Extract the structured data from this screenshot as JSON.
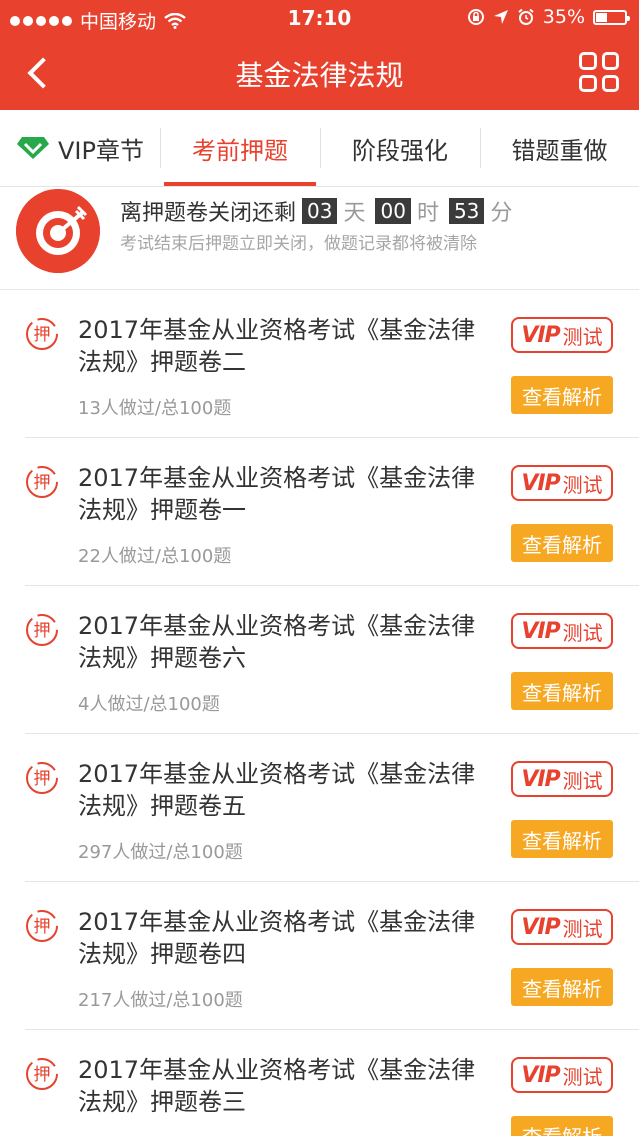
{
  "status_bar": {
    "carrier": "中国移动",
    "time": "17:10",
    "battery": "35%",
    "battery_level": 0.35
  },
  "nav": {
    "title": "基金法律法规"
  },
  "tabs": [
    {
      "label": "VIP章节",
      "active": false
    },
    {
      "label": "考前押题",
      "active": true
    },
    {
      "label": "阶段强化",
      "active": false
    },
    {
      "label": "错题重做",
      "active": false
    }
  ],
  "countdown": {
    "prefix": "离押题卷关闭还剩",
    "days": "03",
    "days_unit": "天",
    "hours": "00",
    "hours_unit": "时",
    "minutes": "53",
    "minutes_unit": "分",
    "note": "考试结束后押题立即关闭，做题记录都将被清除"
  },
  "item_labels": {
    "stamp": "押",
    "vip_tag": "VIP",
    "vip_text": "测试",
    "analysis": "查看解析"
  },
  "exams": [
    {
      "title": "2017年基金从业资格考试《基金法律法规》押题卷二",
      "meta": "13人做过/总100题"
    },
    {
      "title": "2017年基金从业资格考试《基金法律法规》押题卷一",
      "meta": "22人做过/总100题"
    },
    {
      "title": "2017年基金从业资格考试《基金法律法规》押题卷六",
      "meta": "4人做过/总100题"
    },
    {
      "title": "2017年基金从业资格考试《基金法律法规》押题卷五",
      "meta": "297人做过/总100题"
    },
    {
      "title": "2017年基金从业资格考试《基金法律法规》押题卷四",
      "meta": "217人做过/总100题"
    },
    {
      "title": "2017年基金从业资格考试《基金法律法规》押题卷三",
      "meta": ""
    }
  ],
  "colors": {
    "primary": "#e8412e",
    "accent": "#f7a823",
    "vip_green": "#27a84a"
  }
}
